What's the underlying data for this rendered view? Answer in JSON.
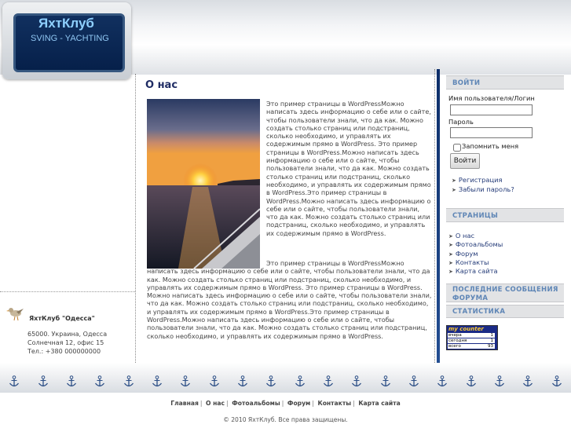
{
  "header": {
    "logo_title": "ЯхтКлуб",
    "logo_subtitle": "SVING - YACHTING"
  },
  "main": {
    "title": "О нас",
    "paragraph1": "Это пример страницы в  WordPressМожно написать здесь информацию о себе или о сайте, чтобы пользователи знали, что да как. Можно создать столько страниц или подстраниц, сколько необходимо, и управлять их содержимым прямо в WordPress. Это пример страницы в  WordPress.Можно написать здесь информацию о себе или о сайте, чтобы пользователи знали, что да как. Можно создать столько страниц или подстраниц, сколько необходимо, и управлять их содержимым прямо в  WordPress.Это пример страницы в  WordPress.Можно написать здесь информацию о себе или о сайте, чтобы пользователи знали, что да как. Можно создать столько страниц или подстраниц, сколько необходимо, и управлять их содержимым прямо в WordPress.",
    "paragraph2": "Это пример страницы в  WordPressМожно написать здесь информацию о себе или о сайте, чтобы пользователи знали, что да как. Можно создать столько страниц или подстраниц, сколько необходимо, и управлять их содержимым прямо в WordPress. Это пример страницы в WordPress. Можно написать здесь информацию о себе или о сайте, чтобы пользователи знали, что да как. Можно создать столько страниц или подстраниц, сколько необходимо, и управлять их содержимым прямо в  WordPress.Это пример страницы в  WordPress.Можно написать здесь информацию о себе или о сайте, чтобы пользователи знали, что да как. Можно создать столько страниц или подстраниц, сколько необходимо, и управлять их содержимым прямо в WordPress."
  },
  "left_sidebar": {
    "club_name": "ЯхтКлуб \"Одесса\"",
    "address_line1": "65000. Украина, Одесса",
    "address_line2": "Солнечная 12, офис 15",
    "address_line3": "Тел.: +380 000000000"
  },
  "login": {
    "heading": "ВОЙТИ",
    "username_label": "Имя пользователя/Логин",
    "password_label": "Пароль",
    "username_value": "",
    "password_value": "",
    "remember_label": "Запомнить меня",
    "submit_label": "Войти",
    "register_link": "Регистрация",
    "forgot_link": "Забыли пароль?"
  },
  "pages": {
    "heading": "СТРАНИЦЫ",
    "items": [
      "О нас",
      "Фотоальбомы",
      "Форум",
      "Контакты",
      "Карта сайта"
    ]
  },
  "forum": {
    "heading": "ПОСЛЕДНИЕ СООБЩЕНИЯ ФОРУМА"
  },
  "stats": {
    "heading": "СТАТИСТИКА",
    "counter_title": "my counter",
    "rows": [
      {
        "label": "вчера",
        "value": "1"
      },
      {
        "label": "сегодня",
        "value": "1"
      },
      {
        "label": "всего",
        "value": "93"
      }
    ]
  },
  "footer": {
    "nav": [
      "Главная",
      "О нас",
      "Фотоальбомы",
      "Форум",
      "Контакты",
      "Карта сайта"
    ],
    "separator": "|",
    "copyright": "© 2010 ЯхтКлуб. Все права защищены."
  },
  "colors": {
    "heading_blue": "#1f2c64",
    "panel_heading_text": "#5f86b6",
    "link_blue": "#243b78",
    "logo_bg": "#0a2654"
  }
}
